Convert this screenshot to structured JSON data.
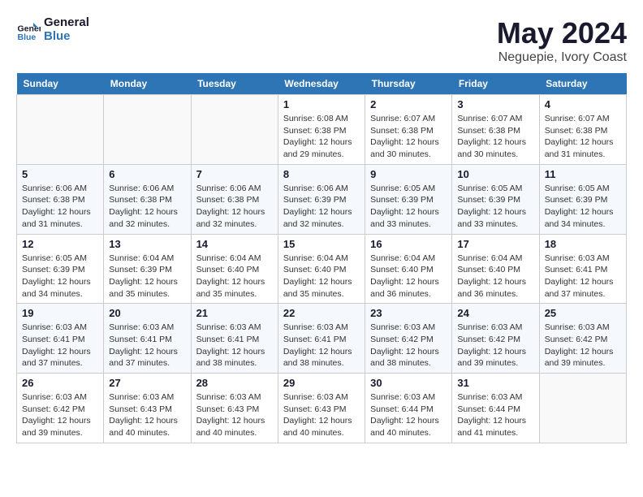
{
  "logo": {
    "line1": "General",
    "line2": "Blue"
  },
  "title": "May 2024",
  "location": "Neguepie, Ivory Coast",
  "weekdays": [
    "Sunday",
    "Monday",
    "Tuesday",
    "Wednesday",
    "Thursday",
    "Friday",
    "Saturday"
  ],
  "weeks": [
    [
      {
        "day": "",
        "info": ""
      },
      {
        "day": "",
        "info": ""
      },
      {
        "day": "",
        "info": ""
      },
      {
        "day": "1",
        "sunrise": "6:08 AM",
        "sunset": "6:38 PM",
        "daylight": "12 hours and 29 minutes."
      },
      {
        "day": "2",
        "sunrise": "6:07 AM",
        "sunset": "6:38 PM",
        "daylight": "12 hours and 30 minutes."
      },
      {
        "day": "3",
        "sunrise": "6:07 AM",
        "sunset": "6:38 PM",
        "daylight": "12 hours and 30 minutes."
      },
      {
        "day": "4",
        "sunrise": "6:07 AM",
        "sunset": "6:38 PM",
        "daylight": "12 hours and 31 minutes."
      }
    ],
    [
      {
        "day": "5",
        "sunrise": "6:06 AM",
        "sunset": "6:38 PM",
        "daylight": "12 hours and 31 minutes."
      },
      {
        "day": "6",
        "sunrise": "6:06 AM",
        "sunset": "6:38 PM",
        "daylight": "12 hours and 32 minutes."
      },
      {
        "day": "7",
        "sunrise": "6:06 AM",
        "sunset": "6:38 PM",
        "daylight": "12 hours and 32 minutes."
      },
      {
        "day": "8",
        "sunrise": "6:06 AM",
        "sunset": "6:39 PM",
        "daylight": "12 hours and 32 minutes."
      },
      {
        "day": "9",
        "sunrise": "6:05 AM",
        "sunset": "6:39 PM",
        "daylight": "12 hours and 33 minutes."
      },
      {
        "day": "10",
        "sunrise": "6:05 AM",
        "sunset": "6:39 PM",
        "daylight": "12 hours and 33 minutes."
      },
      {
        "day": "11",
        "sunrise": "6:05 AM",
        "sunset": "6:39 PM",
        "daylight": "12 hours and 34 minutes."
      }
    ],
    [
      {
        "day": "12",
        "sunrise": "6:05 AM",
        "sunset": "6:39 PM",
        "daylight": "12 hours and 34 minutes."
      },
      {
        "day": "13",
        "sunrise": "6:04 AM",
        "sunset": "6:39 PM",
        "daylight": "12 hours and 35 minutes."
      },
      {
        "day": "14",
        "sunrise": "6:04 AM",
        "sunset": "6:40 PM",
        "daylight": "12 hours and 35 minutes."
      },
      {
        "day": "15",
        "sunrise": "6:04 AM",
        "sunset": "6:40 PM",
        "daylight": "12 hours and 35 minutes."
      },
      {
        "day": "16",
        "sunrise": "6:04 AM",
        "sunset": "6:40 PM",
        "daylight": "12 hours and 36 minutes."
      },
      {
        "day": "17",
        "sunrise": "6:04 AM",
        "sunset": "6:40 PM",
        "daylight": "12 hours and 36 minutes."
      },
      {
        "day": "18",
        "sunrise": "6:03 AM",
        "sunset": "6:41 PM",
        "daylight": "12 hours and 37 minutes."
      }
    ],
    [
      {
        "day": "19",
        "sunrise": "6:03 AM",
        "sunset": "6:41 PM",
        "daylight": "12 hours and 37 minutes."
      },
      {
        "day": "20",
        "sunrise": "6:03 AM",
        "sunset": "6:41 PM",
        "daylight": "12 hours and 37 minutes."
      },
      {
        "day": "21",
        "sunrise": "6:03 AM",
        "sunset": "6:41 PM",
        "daylight": "12 hours and 38 minutes."
      },
      {
        "day": "22",
        "sunrise": "6:03 AM",
        "sunset": "6:41 PM",
        "daylight": "12 hours and 38 minutes."
      },
      {
        "day": "23",
        "sunrise": "6:03 AM",
        "sunset": "6:42 PM",
        "daylight": "12 hours and 38 minutes."
      },
      {
        "day": "24",
        "sunrise": "6:03 AM",
        "sunset": "6:42 PM",
        "daylight": "12 hours and 39 minutes."
      },
      {
        "day": "25",
        "sunrise": "6:03 AM",
        "sunset": "6:42 PM",
        "daylight": "12 hours and 39 minutes."
      }
    ],
    [
      {
        "day": "26",
        "sunrise": "6:03 AM",
        "sunset": "6:42 PM",
        "daylight": "12 hours and 39 minutes."
      },
      {
        "day": "27",
        "sunrise": "6:03 AM",
        "sunset": "6:43 PM",
        "daylight": "12 hours and 40 minutes."
      },
      {
        "day": "28",
        "sunrise": "6:03 AM",
        "sunset": "6:43 PM",
        "daylight": "12 hours and 40 minutes."
      },
      {
        "day": "29",
        "sunrise": "6:03 AM",
        "sunset": "6:43 PM",
        "daylight": "12 hours and 40 minutes."
      },
      {
        "day": "30",
        "sunrise": "6:03 AM",
        "sunset": "6:44 PM",
        "daylight": "12 hours and 40 minutes."
      },
      {
        "day": "31",
        "sunrise": "6:03 AM",
        "sunset": "6:44 PM",
        "daylight": "12 hours and 41 minutes."
      },
      {
        "day": "",
        "info": ""
      }
    ]
  ],
  "labels": {
    "sunrise": "Sunrise:",
    "sunset": "Sunset:",
    "daylight": "Daylight:"
  }
}
